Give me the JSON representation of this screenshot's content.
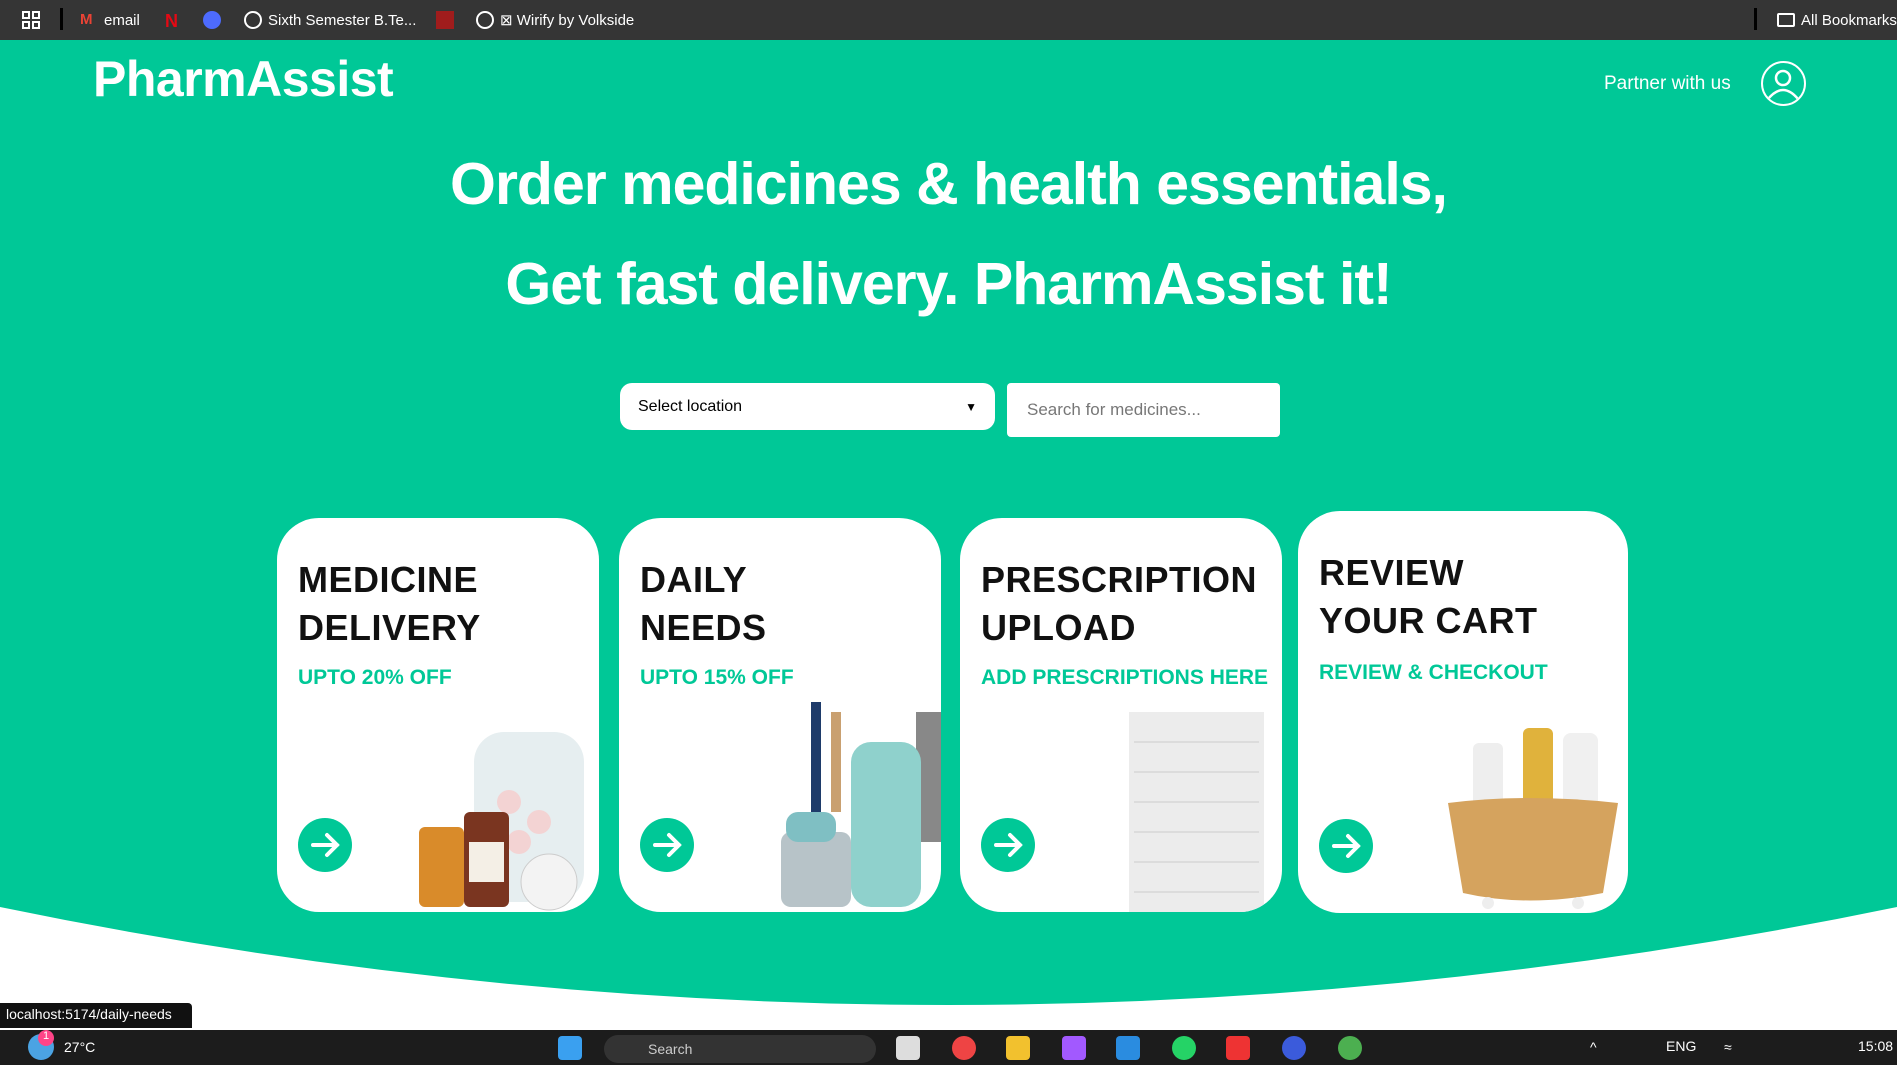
{
  "bookmarks": [
    {
      "label": "email",
      "icon": "gmail-icon"
    },
    {
      "label": "",
      "icon": "netflix-icon"
    },
    {
      "label": "",
      "icon": "deepseek-icon"
    },
    {
      "label": "Sixth Semester B.Te...",
      "icon": "globe-icon"
    },
    {
      "label": "",
      "icon": "red-site-icon"
    },
    {
      "label": "⊠ Wirify by Volkside",
      "icon": "globe-icon"
    }
  ],
  "all_bookmarks": "All Bookmarks",
  "header": {
    "logo": "PharmAssist",
    "partner": "Partner with us"
  },
  "hero": {
    "line1": "Order medicines & health essentials,",
    "line2": "Get fast delivery. PharmAssist it!"
  },
  "location": {
    "selected": "Select location"
  },
  "search": {
    "placeholder": "Search for medicines..."
  },
  "cards": [
    {
      "title1": "MEDICINE",
      "title2": "DELIVERY",
      "subtitle": "UPTO 20% OFF"
    },
    {
      "title1": "DAILY",
      "title2": "NEEDS",
      "subtitle": "UPTO 15% OFF"
    },
    {
      "title1": "PRESCRIPTION",
      "title2": "UPLOAD",
      "subtitle": "ADD PRESCRIPTIONS HERE"
    },
    {
      "title1": "REVIEW",
      "title2": "YOUR CART",
      "subtitle": "REVIEW & CHECKOUT"
    }
  ],
  "status_url": "localhost:5174/daily-needs",
  "taskbar": {
    "weather": "27°C",
    "search": "Search",
    "lang": "ENG",
    "time": "15:08",
    "notif": "1"
  },
  "colors": {
    "accent": "#00c897"
  }
}
